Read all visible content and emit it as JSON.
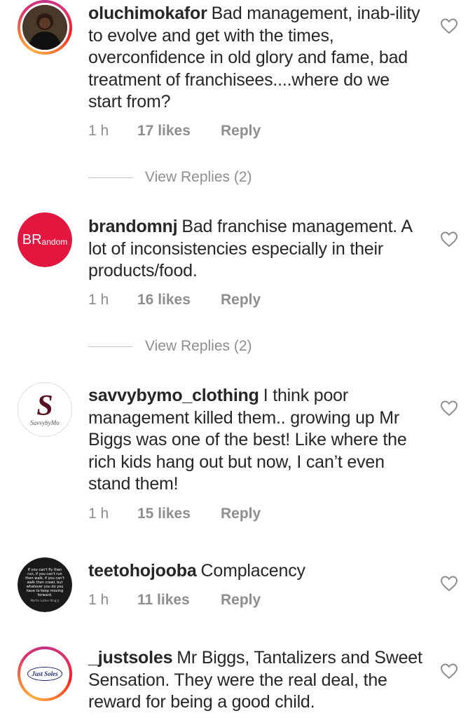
{
  "comments": [
    {
      "username": "oluchimokafor",
      "text": "Bad management, inab-ility to evolve and get with the times, overconfidence in old glory and fame, bad treatment of franchisees....where do we start from?",
      "time": "1 h",
      "likes": "17 likes",
      "reply": "Reply",
      "view_replies": "View Replies (2)"
    },
    {
      "username": "brandomnj",
      "text": "Bad franchise management. A lot of inconsistencies especially in their products/food.",
      "avatar_text_big": "BR",
      "avatar_text_small": "andom",
      "time": "1 h",
      "likes": "16 likes",
      "reply": "Reply",
      "view_replies": "View Replies (2)"
    },
    {
      "username": "savvybymo_clothing",
      "text": "I think poor management killed them.. growing up Mr Biggs was one of the best! Like where the rich kids hang out but now, I can’t even stand them!",
      "avatar_text_big": "S",
      "avatar_text_small": "SavvybyMo",
      "time": "1 h",
      "likes": "15 likes",
      "reply": "Reply"
    },
    {
      "username": "teetohojooba",
      "text": "Complacency",
      "avatar_text": "If you can't fly then run, if you can't run then walk, if you can't walk then crawl, but whatever you do you have to keep moving forward.",
      "avatar_credit": "Martin Luther King Jr",
      "time": "1 h",
      "likes": "11 likes",
      "reply": "Reply"
    },
    {
      "username": "_justsoles",
      "text": "Mr Biggs, Tantalizers and Sweet Sensation. They were the real deal, the reward for being a good child.",
      "avatar_text": "Just Soles"
    }
  ],
  "colors": {
    "text": "#262626",
    "secondary": "#8e8e8e",
    "brandomnj_red": "#e3163f",
    "savvy_maroon": "#5a1220"
  }
}
